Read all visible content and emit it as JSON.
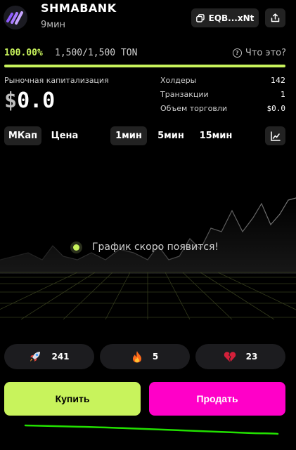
{
  "header": {
    "token_name": "SHMABANK",
    "age": "9мин",
    "address": "EQB...xNt"
  },
  "progress": {
    "percent_text": "100.00%",
    "ton_text": "1,500/1,500 TON",
    "percent_value": 1.0,
    "what_label": "Что это?"
  },
  "market_cap": {
    "label": "Рыночная капитализация",
    "currency": "$",
    "value": "0.0"
  },
  "stats": {
    "holders_label": "Холдеры",
    "holders_value": "142",
    "tx_label": "Транзакции",
    "tx_value": "1",
    "volume_label": "Объем торговли",
    "volume_value": "$0.0"
  },
  "tabs": {
    "mcap": "МКап",
    "price": "Цена",
    "m1": "1мин",
    "m5": "5мин",
    "m15": "15мин"
  },
  "chart": {
    "placeholder": "График скоро появится!"
  },
  "reactions": {
    "rocket": "241",
    "fire": "5",
    "broken_heart": "23"
  },
  "actions": {
    "buy": "Купить",
    "sell": "Продать"
  },
  "colors": {
    "accent": "#c8f35c",
    "sell": "#ff00c8",
    "annotation": "#22e000"
  },
  "icons": [
    "token-logo-icon",
    "copy-icon",
    "share-icon",
    "question-icon",
    "line-chart-icon",
    "rocket-icon",
    "fire-icon",
    "broken-heart-icon"
  ]
}
